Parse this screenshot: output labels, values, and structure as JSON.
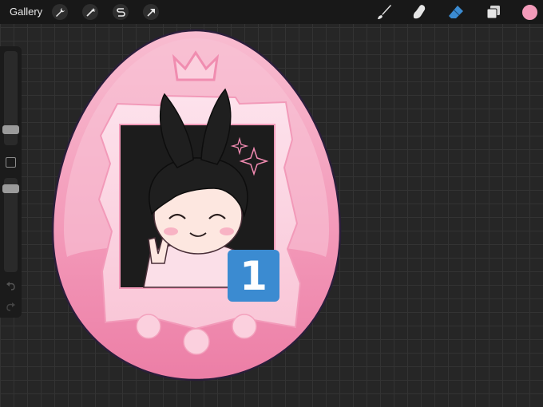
{
  "toolbar": {
    "gallery_label": "Gallery",
    "left_tools": [
      {
        "name": "actions",
        "icon": "wrench-icon"
      },
      {
        "name": "adjustments",
        "icon": "magic-wand-icon"
      },
      {
        "name": "selection",
        "icon": "selection-s-icon"
      },
      {
        "name": "transform",
        "icon": "arrow-cursor-icon"
      }
    ],
    "right_tools": [
      {
        "name": "brush",
        "icon": "brush-icon"
      },
      {
        "name": "smudge",
        "icon": "smudge-finger-icon"
      },
      {
        "name": "eraser",
        "icon": "eraser-icon",
        "active_color": "#3b8bd1"
      },
      {
        "name": "layers",
        "icon": "layers-icon"
      }
    ],
    "current_color": "#f39bba"
  },
  "sidebar": {
    "brush_size_level": 0.3,
    "opacity_level": 0.95
  },
  "canvas": {
    "background": "#262626",
    "artwork": {
      "device_color": "#f5a6c1",
      "device_dark": "#e9769f",
      "frame_color": "#fdd5e2",
      "screen_color": "#1c1c1c"
    },
    "badge": {
      "text": "1",
      "color": "#3b8bd1"
    }
  }
}
